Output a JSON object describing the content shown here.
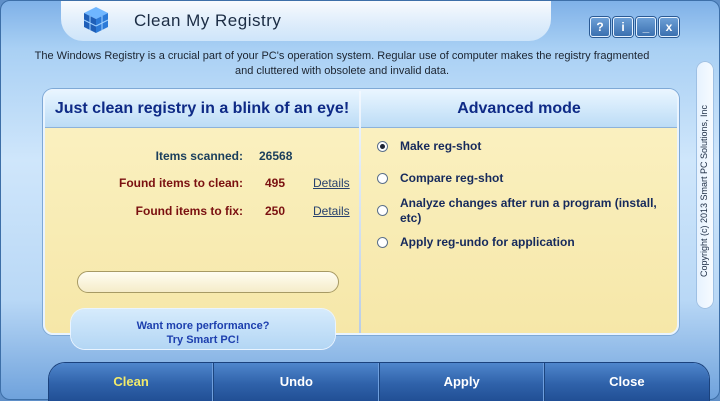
{
  "window": {
    "title": "Clean My Registry",
    "buttons": [
      "?",
      "i",
      "_",
      "x"
    ]
  },
  "intro": {
    "line1": "The Windows Registry is a crucial part of your PC's operation system. Regular use of computer makes the registry fragmented",
    "line2": "and cluttered with obsolete and invalid data."
  },
  "quick": {
    "heading": "Just clean registry in a blink of an eye!",
    "scanned_label": "Items scanned:",
    "scanned_value": "26568",
    "clean_label": "Found items to clean:",
    "clean_value": "495",
    "fix_label": "Found items to fix:",
    "fix_value": "250",
    "details_label": "Details",
    "progress_fraction": 0
  },
  "advanced": {
    "heading": "Advanced mode",
    "options": [
      {
        "label": "Make reg-shot",
        "selected": true
      },
      {
        "label": "Compare reg-shot",
        "selected": false
      },
      {
        "label": "Analyze changes after run a program (install, etc)",
        "selected": false
      },
      {
        "label": "Apply reg-undo for application",
        "selected": false
      }
    ]
  },
  "promo": {
    "line1": "Want more performance?",
    "line2": "Try Smart PC!"
  },
  "copyright": "Copyright (c) 2013 Smart PC Solutions, Inc",
  "actions": [
    "Clean",
    "Undo",
    "Apply",
    "Close"
  ],
  "colors": {
    "accent_text": "#0e2a86",
    "dark_red": "#7a1010",
    "active_button": "#f2ea6a"
  }
}
